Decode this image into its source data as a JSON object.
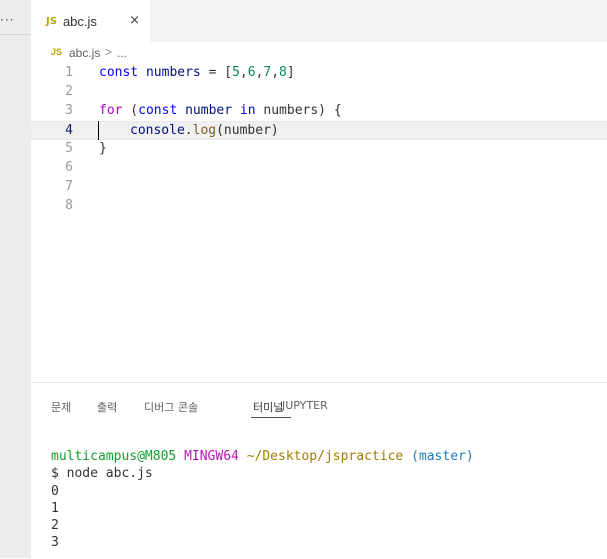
{
  "left_panel": {
    "more_label": "···"
  },
  "tab": {
    "icon": "JS",
    "title": "abc.js",
    "close": "×"
  },
  "breadcrumb": {
    "icon": "JS",
    "file": "abc.js",
    "separator": ">",
    "more": "..."
  },
  "editor": {
    "lines": [
      {
        "number": "1"
      },
      {
        "number": "2"
      },
      {
        "number": "3"
      },
      {
        "number": "4"
      },
      {
        "number": "5"
      },
      {
        "number": "6"
      },
      {
        "number": "7"
      },
      {
        "number": "8"
      }
    ],
    "tokens": {
      "l1_kw": "const",
      "l1_var": " numbers",
      "l1_rest": " = [",
      "l1_n1": "5",
      "l1_c1": ",",
      "l1_n2": "6",
      "l1_c2": ",",
      "l1_n3": "7",
      "l1_c3": ",",
      "l1_n4": "8",
      "l1_end": "]",
      "l3_for": "for",
      "l3_p1": " (",
      "l3_const": "const",
      "l3_var": " number",
      "l3_in": " in",
      "l3_rest": " numbers) {",
      "l4_obj": "console",
      "l4_dot": ".",
      "l4_fn": "log",
      "l4_rest": "(number)",
      "l5": "}"
    }
  },
  "panel": {
    "tabs": [
      "문제",
      "출력",
      "디버그 콘솔",
      "터미널",
      "JUPYTER"
    ],
    "active_tab": "터미널"
  },
  "terminal": {
    "prompt_user": "multicampus@M805",
    "prompt_sys": "MINGW64",
    "prompt_path": "~/Desktop/jspractice",
    "prompt_branch": "(master)",
    "command": "$ node abc.js",
    "output": [
      "0",
      "1",
      "2",
      "3"
    ]
  }
}
